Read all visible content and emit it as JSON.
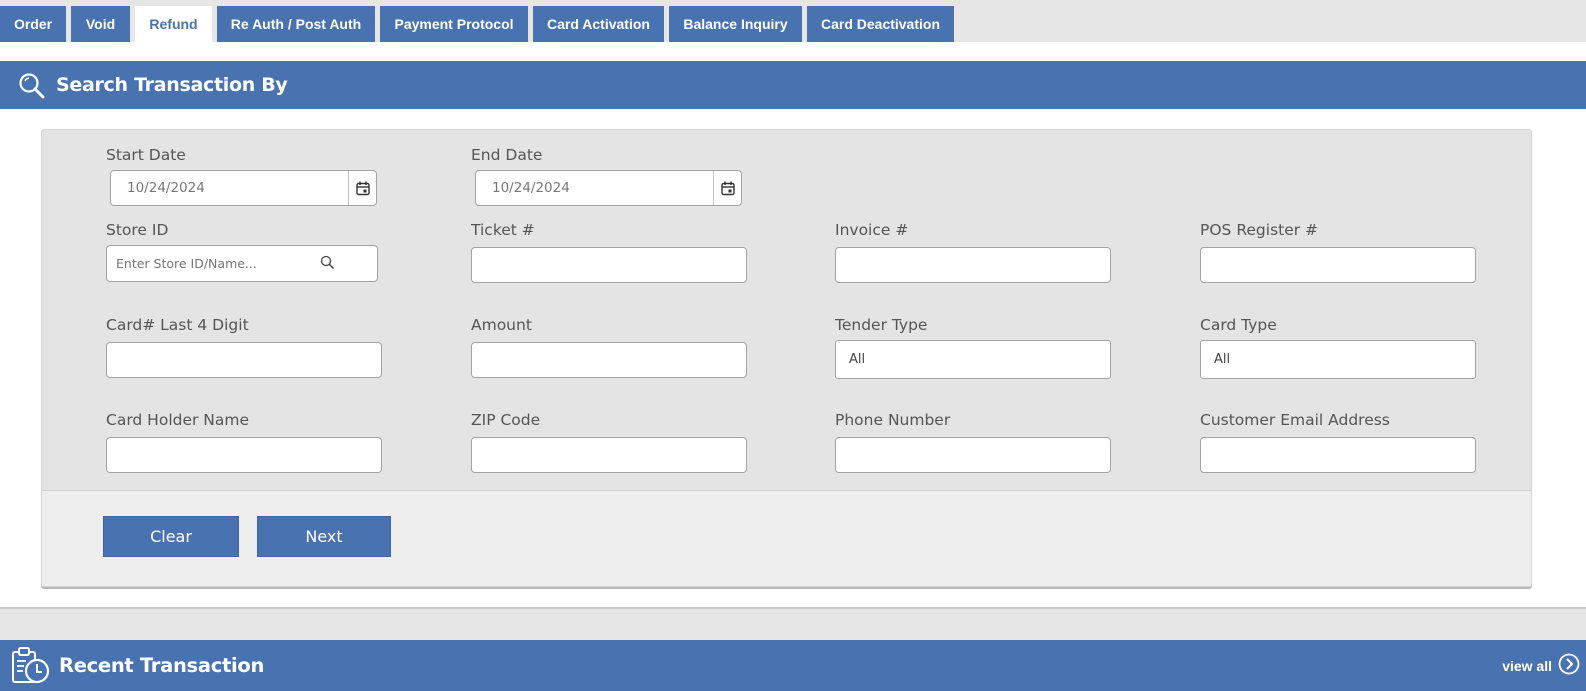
{
  "tabs": [
    {
      "label": "Order"
    },
    {
      "label": "Void"
    },
    {
      "label": "Refund",
      "active": true
    },
    {
      "label": "Re Auth / Post Auth"
    },
    {
      "label": "Payment Protocol"
    },
    {
      "label": "Card Activation"
    },
    {
      "label": "Balance Inquiry"
    },
    {
      "label": "Card Deactivation"
    }
  ],
  "search_section": {
    "title": "Search Transaction By",
    "icon": "magnifier-icon"
  },
  "form": {
    "start_date": {
      "label": "Start Date",
      "value": "10/24/2024"
    },
    "end_date": {
      "label": "End Date",
      "value": "10/24/2024"
    },
    "store_id": {
      "label": "Store ID",
      "placeholder": "Enter Store ID/Name..."
    },
    "ticket": {
      "label": "Ticket #",
      "value": ""
    },
    "invoice": {
      "label": "Invoice #",
      "value": ""
    },
    "pos_register": {
      "label": "POS Register #",
      "value": ""
    },
    "card_last4": {
      "label": "Card# Last 4 Digit",
      "value": ""
    },
    "amount": {
      "label": "Amount",
      "value": ""
    },
    "tender_type": {
      "label": "Tender Type",
      "selected": "All"
    },
    "card_type": {
      "label": "Card Type",
      "selected": "All"
    },
    "card_holder": {
      "label": "Card Holder Name",
      "value": ""
    },
    "zip": {
      "label": "ZIP Code",
      "value": ""
    },
    "phone": {
      "label": "Phone Number",
      "value": ""
    },
    "email": {
      "label": "Customer Email Address",
      "value": ""
    }
  },
  "actions": {
    "clear_label": "Clear",
    "next_label": "Next"
  },
  "recent_section": {
    "title": "Recent Transaction",
    "view_all_label": "view all",
    "icon": "clipboard-clock-icon"
  },
  "colors": {
    "primary": "#4872b0",
    "panel_bg": "#e4e4e4",
    "tab_bar_bg": "#e6e6e6"
  }
}
